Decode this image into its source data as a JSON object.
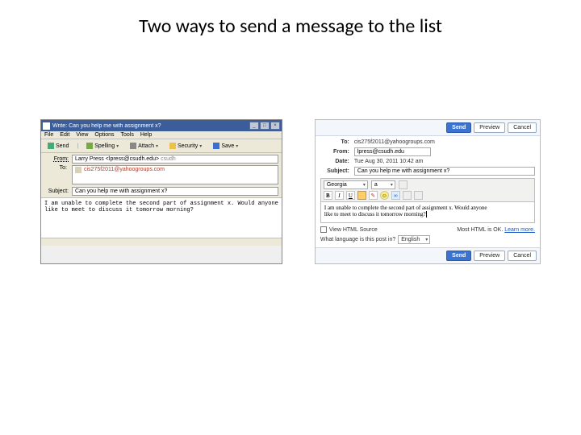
{
  "slide": {
    "title": "Two ways to send a message to the list"
  },
  "left": {
    "window_title": "Write: Can you help me with assignment x?",
    "menus": {
      "file": "File",
      "edit": "Edit",
      "view": "View",
      "options": "Options",
      "tools": "Tools",
      "help": "Help"
    },
    "toolbar": {
      "send": "Send",
      "spelling": "Spelling",
      "attach": "Attach",
      "security": "Security",
      "save": "Save"
    },
    "fields": {
      "from_label": "From:",
      "from_name": "Larry Press",
      "from_addr": "<lpress@csudh.edu>",
      "from_suffix": "csudh",
      "to_label": "To:",
      "to_value": "cis275f2011@yahoogroups.com",
      "subject_label": "Subject:",
      "subject_value": "Can you help me with assignment x?"
    },
    "body_line1": "I am unable to complete the second part of assignment x.  Would anyone",
    "body_line2": "like to meet to discuss it tomorrow morning?"
  },
  "right": {
    "buttons": {
      "send": "Send",
      "preview": "Preview",
      "cancel": "Cancel"
    },
    "fields": {
      "to_label": "To:",
      "to_value": "cis275f2011@yahoogroups.com",
      "from_label": "From:",
      "from_value": "lpress@csudh.edu",
      "date_label": "Date:",
      "date_value": "Tue Aug 30, 2011 10:42 am",
      "subject_label": "Subject:",
      "subject_value": "Can you help me with assignment x?"
    },
    "editor": {
      "font": "Georgia",
      "size": "a",
      "fmt_bold": "B",
      "fmt_italic": "I",
      "fmt_underline": "U",
      "body_l1": "I am unable to complete the second part of assignment x. Would anyone",
      "body_l2": "like to meet to discuss it tomorrow morning?"
    },
    "view_html_label": "View HTML Source",
    "most_html_note": "Most HTML is OK.",
    "learn_more": "Learn more.",
    "lang_q": "What language is this post in?",
    "lang_value": "English"
  }
}
